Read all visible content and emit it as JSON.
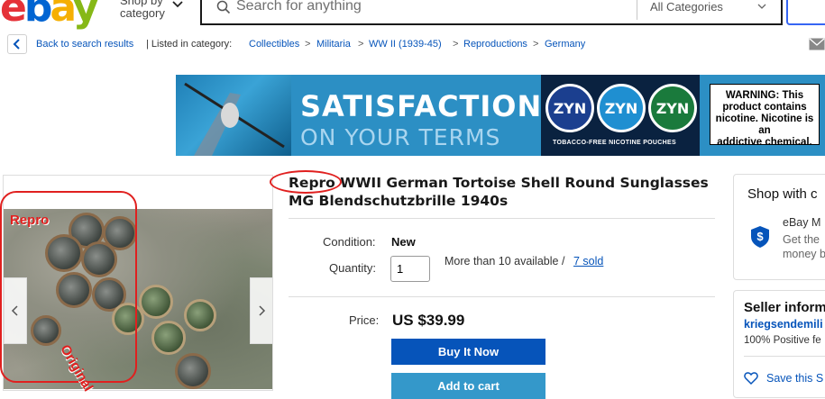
{
  "header": {
    "logo_letters": [
      "e",
      "b",
      "a",
      "y"
    ],
    "shop_by_line1": "Shop by",
    "shop_by_line2": "category",
    "search_placeholder": "Search for anything",
    "category_select": "All Categories"
  },
  "breadcrumb": {
    "back_label": "Back to search results",
    "listed_in": "| Listed in category:",
    "items": [
      "Collectibles",
      "Militaria",
      "WW II (1939-45)",
      "Reproductions",
      "Germany"
    ],
    "separator": ">"
  },
  "ad": {
    "headline": "SATISFACTION",
    "subline": "ON YOUR TERMS",
    "brand_badges": [
      {
        "text": "ZYN",
        "color": "#1b3f8f"
      },
      {
        "text": "ZYN",
        "color": "#1f8fd1"
      },
      {
        "text": "ZYN",
        "color": "#1a7a3c"
      }
    ],
    "tagline": "TOBACCO-FREE NICOTINE POUCHES",
    "warning_line1": "WARNING: This",
    "warning_line2": "product contains",
    "warning_line3": "nicotine. Nicotine is an",
    "warning_line4": "addictive chemical."
  },
  "gallery": {
    "overlay_repro": "Repro",
    "overlay_original": "Original"
  },
  "item": {
    "title": "Repro WWII German Tortoise Shell Round Sunglasses MG Blendschutzbrille 1940s",
    "condition_label": "Condition:",
    "condition_value": "New",
    "quantity_label": "Quantity:",
    "quantity_value": "1",
    "availability": "More than 10 available /",
    "sold_link": "7 sold",
    "price_label": "Price:",
    "price_value": "US $39.99",
    "buy_now": "Buy It Now",
    "add_to_cart": "Add to cart"
  },
  "shop_card": {
    "title": "Shop with c",
    "line1": "eBay M",
    "line2": "Get the",
    "line3": "money b"
  },
  "seller": {
    "title": "Seller inform",
    "name": "kriegsendemili",
    "feedback": "100% Positive fe",
    "save": "Save this S"
  },
  "colors": {
    "ebay_red": "#e53238",
    "ebay_blue": "#0064d2",
    "ebay_yellow": "#f5af02",
    "ebay_green": "#86b817",
    "link": "#0654ba",
    "buy_now_bg": "#0654ba",
    "add_cart_bg": "#3498ca",
    "annotation_red": "#e0201f"
  }
}
